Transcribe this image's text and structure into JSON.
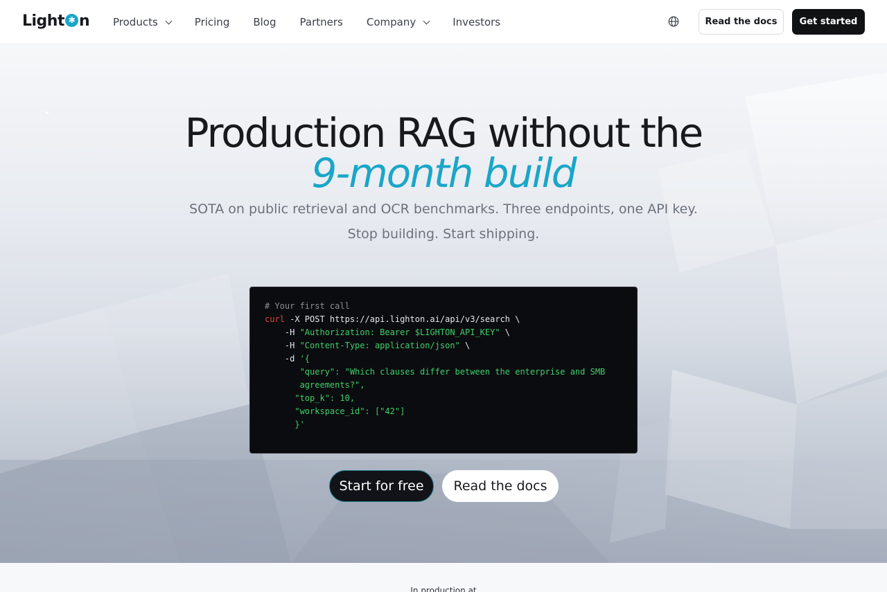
{
  "nav": {
    "logo_text": {
      "pre": "Light",
      "post": "n"
    },
    "links": [
      {
        "label": "Products",
        "has_dropdown": true
      },
      {
        "label": "Pricing",
        "has_dropdown": false
      },
      {
        "label": "Blog",
        "has_dropdown": false
      },
      {
        "label": "Partners",
        "has_dropdown": false
      },
      {
        "label": "Company",
        "has_dropdown": true
      },
      {
        "label": "Investors",
        "has_dropdown": false
      }
    ],
    "language_icon": "globe-icon",
    "docs_label": "Read the docs",
    "get_started_label": "Get started"
  },
  "hero": {
    "title": "Production RAG without the",
    "title_accent": "9-month build",
    "subtitle_line1": "SOTA on public retrieval and OCR benchmarks. Three endpoints, one API key.",
    "subtitle_line2": "Stop building. Start shipping.",
    "code": {
      "comment": "# Your first call",
      "cmd": "curl",
      "cmd_rest": " -X POST https://api.lighton.ai/api/v3/search \\",
      "h1_flag": "    -H ",
      "h1_value": "\"Authorization: Bearer $LIGHTON_API_KEY\"",
      "h1_tail": " \\",
      "h2_flag": "    -H ",
      "h2_value": "\"Content-Type: application/json\"",
      "h2_tail": " \\",
      "d_flag": "    -d ",
      "d_open": "'{",
      "q1": "       \"query\": \"Which clauses differ between the enterprise and SMB",
      "q2": "       agreements?\",",
      "topk": "      \"top_k\": 10,",
      "ws": "      \"workspace_id\": [\"42\"]",
      "close": "      }'"
    },
    "primary_cta": "Start for free",
    "secondary_cta": "Read the docs"
  },
  "colors": {
    "accent": "#1aa6c8",
    "dark": "#111214"
  },
  "trust": {
    "label": "In production at"
  }
}
